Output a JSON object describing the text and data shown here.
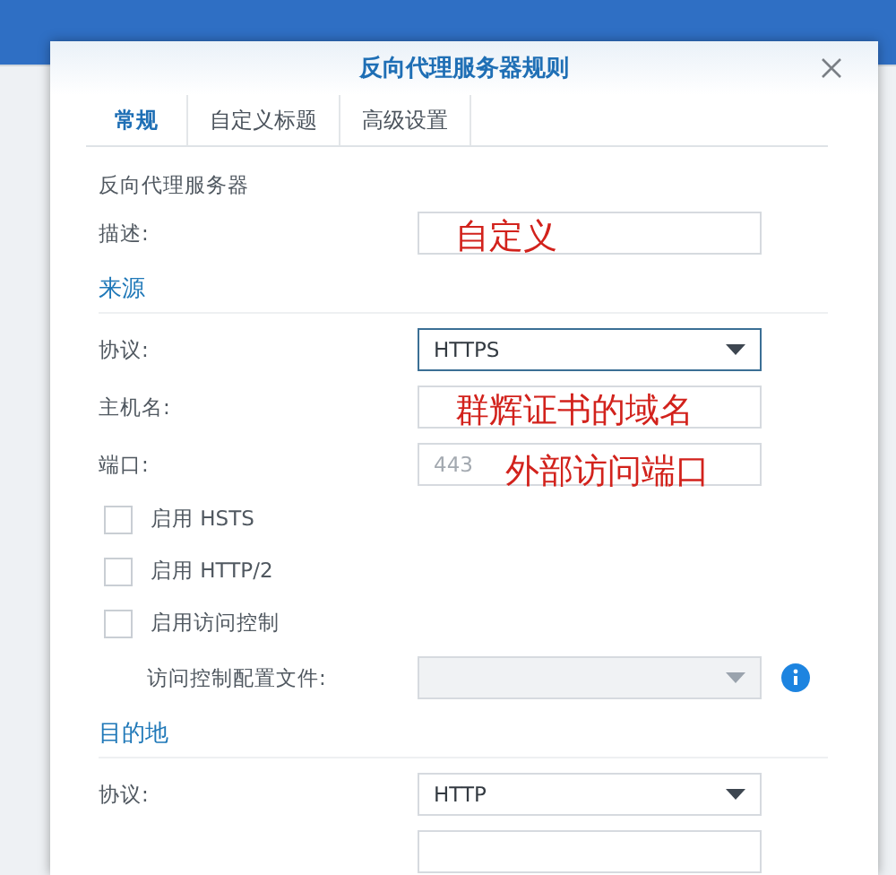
{
  "dialog": {
    "title": "反向代理服务器规则"
  },
  "tabs": [
    {
      "label": "常规",
      "selected": true
    },
    {
      "label": "自定义标题",
      "selected": false
    },
    {
      "label": "高级设置",
      "selected": false
    }
  ],
  "intro": "反向代理服务器",
  "description": {
    "label": "描述:",
    "annotation": "自定义"
  },
  "source": {
    "heading": "来源",
    "rows": [
      {
        "kind": "select",
        "label": "协议:",
        "value": "HTTPS",
        "focused": true
      },
      {
        "kind": "field",
        "label": "主机名:",
        "annotation": "群辉证书的域名"
      },
      {
        "kind": "field",
        "label": "端口:",
        "placeholder": "443",
        "annotation": "外部访问端口"
      },
      {
        "kind": "checkbox",
        "label": "启用 HSTS",
        "checked": false
      },
      {
        "kind": "checkbox",
        "label": "启用 HTTP/2",
        "checked": false
      },
      {
        "kind": "checkbox",
        "label": "启用访问控制",
        "checked": false
      },
      {
        "kind": "select",
        "label": "访问控制配置文件:",
        "disabled": true,
        "info": true
      }
    ]
  },
  "destination": {
    "heading": "目的地",
    "rows": [
      {
        "kind": "select",
        "label": "协议:",
        "value": "HTTP",
        "focused": false
      },
      {
        "kind": "field"
      }
    ]
  }
}
